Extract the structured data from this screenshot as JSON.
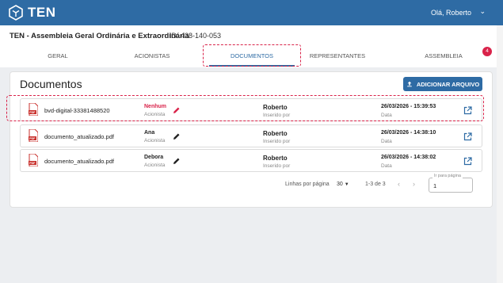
{
  "app": {
    "logo_text": "TEN",
    "greeting": "Olá, Roberto"
  },
  "assembly": {
    "title": "TEN - Assembleia Geral Ordinária e Extraordinária",
    "id_text": "ID: 428-140-053"
  },
  "tabs": [
    {
      "label": "GERAL"
    },
    {
      "label": "ACIONISTAS"
    },
    {
      "label": "DOCUMENTOS"
    },
    {
      "label": "REPRESENTANTES"
    },
    {
      "label": "ASSEMBLEIA"
    }
  ],
  "tab_badge": "4",
  "documents": {
    "title": "Documentos",
    "add_button": "ADICIONAR ARQUIVO",
    "rows": [
      {
        "file": "bvd-digital-33381488520",
        "actor": "Nenhum",
        "actor_label": "Acionista",
        "inserted_by": "Roberto",
        "inserted_by_label": "Inserido por",
        "date": "26/03/2026 - 15:39:53",
        "date_label": "Data"
      },
      {
        "file": "documento_atualizado.pdf",
        "actor": "Ana",
        "actor_label": "Acionista",
        "inserted_by": "Roberto",
        "inserted_by_label": "Inserido por",
        "date": "26/03/2026 - 14:38:10",
        "date_label": "Data"
      },
      {
        "file": "documento_atualizado.pdf",
        "actor": "Debora",
        "actor_label": "Acionista",
        "inserted_by": "Roberto",
        "inserted_by_label": "Inserido por",
        "date": "26/03/2026 - 14:38:02",
        "date_label": "Data"
      }
    ]
  },
  "pagination": {
    "rows_per_page_label": "Linhas por página",
    "rows_per_page": "30",
    "range": "1-3 de 3",
    "go_to_label": "Ir para página",
    "page": "1"
  },
  "colors": {
    "primary": "#2e6ba4",
    "danger": "#d9234a"
  }
}
